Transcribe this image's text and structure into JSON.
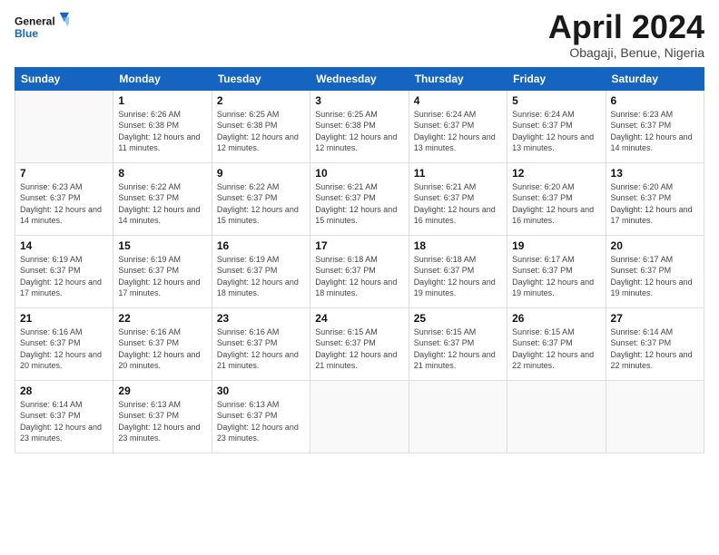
{
  "header": {
    "logo_line1": "General",
    "logo_line2": "Blue",
    "main_title": "April 2024",
    "subtitle": "Obagaji, Benue, Nigeria"
  },
  "calendar": {
    "days_of_week": [
      "Sunday",
      "Monday",
      "Tuesday",
      "Wednesday",
      "Thursday",
      "Friday",
      "Saturday"
    ],
    "weeks": [
      [
        {
          "day": "",
          "info": ""
        },
        {
          "day": "1",
          "info": "Sunrise: 6:26 AM\nSunset: 6:38 PM\nDaylight: 12 hours\nand 11 minutes."
        },
        {
          "day": "2",
          "info": "Sunrise: 6:25 AM\nSunset: 6:38 PM\nDaylight: 12 hours\nand 12 minutes."
        },
        {
          "day": "3",
          "info": "Sunrise: 6:25 AM\nSunset: 6:38 PM\nDaylight: 12 hours\nand 12 minutes."
        },
        {
          "day": "4",
          "info": "Sunrise: 6:24 AM\nSunset: 6:37 PM\nDaylight: 12 hours\nand 13 minutes."
        },
        {
          "day": "5",
          "info": "Sunrise: 6:24 AM\nSunset: 6:37 PM\nDaylight: 12 hours\nand 13 minutes."
        },
        {
          "day": "6",
          "info": "Sunrise: 6:23 AM\nSunset: 6:37 PM\nDaylight: 12 hours\nand 14 minutes."
        }
      ],
      [
        {
          "day": "7",
          "info": "Sunrise: 6:23 AM\nSunset: 6:37 PM\nDaylight: 12 hours\nand 14 minutes."
        },
        {
          "day": "8",
          "info": "Sunrise: 6:22 AM\nSunset: 6:37 PM\nDaylight: 12 hours\nand 14 minutes."
        },
        {
          "day": "9",
          "info": "Sunrise: 6:22 AM\nSunset: 6:37 PM\nDaylight: 12 hours\nand 15 minutes."
        },
        {
          "day": "10",
          "info": "Sunrise: 6:21 AM\nSunset: 6:37 PM\nDaylight: 12 hours\nand 15 minutes."
        },
        {
          "day": "11",
          "info": "Sunrise: 6:21 AM\nSunset: 6:37 PM\nDaylight: 12 hours\nand 16 minutes."
        },
        {
          "day": "12",
          "info": "Sunrise: 6:20 AM\nSunset: 6:37 PM\nDaylight: 12 hours\nand 16 minutes."
        },
        {
          "day": "13",
          "info": "Sunrise: 6:20 AM\nSunset: 6:37 PM\nDaylight: 12 hours\nand 17 minutes."
        }
      ],
      [
        {
          "day": "14",
          "info": "Sunrise: 6:19 AM\nSunset: 6:37 PM\nDaylight: 12 hours\nand 17 minutes."
        },
        {
          "day": "15",
          "info": "Sunrise: 6:19 AM\nSunset: 6:37 PM\nDaylight: 12 hours\nand 17 minutes."
        },
        {
          "day": "16",
          "info": "Sunrise: 6:19 AM\nSunset: 6:37 PM\nDaylight: 12 hours\nand 18 minutes."
        },
        {
          "day": "17",
          "info": "Sunrise: 6:18 AM\nSunset: 6:37 PM\nDaylight: 12 hours\nand 18 minutes."
        },
        {
          "day": "18",
          "info": "Sunrise: 6:18 AM\nSunset: 6:37 PM\nDaylight: 12 hours\nand 19 minutes."
        },
        {
          "day": "19",
          "info": "Sunrise: 6:17 AM\nSunset: 6:37 PM\nDaylight: 12 hours\nand 19 minutes."
        },
        {
          "day": "20",
          "info": "Sunrise: 6:17 AM\nSunset: 6:37 PM\nDaylight: 12 hours\nand 19 minutes."
        }
      ],
      [
        {
          "day": "21",
          "info": "Sunrise: 6:16 AM\nSunset: 6:37 PM\nDaylight: 12 hours\nand 20 minutes."
        },
        {
          "day": "22",
          "info": "Sunrise: 6:16 AM\nSunset: 6:37 PM\nDaylight: 12 hours\nand 20 minutes."
        },
        {
          "day": "23",
          "info": "Sunrise: 6:16 AM\nSunset: 6:37 PM\nDaylight: 12 hours\nand 21 minutes."
        },
        {
          "day": "24",
          "info": "Sunrise: 6:15 AM\nSunset: 6:37 PM\nDaylight: 12 hours\nand 21 minutes."
        },
        {
          "day": "25",
          "info": "Sunrise: 6:15 AM\nSunset: 6:37 PM\nDaylight: 12 hours\nand 21 minutes."
        },
        {
          "day": "26",
          "info": "Sunrise: 6:15 AM\nSunset: 6:37 PM\nDaylight: 12 hours\nand 22 minutes."
        },
        {
          "day": "27",
          "info": "Sunrise: 6:14 AM\nSunset: 6:37 PM\nDaylight: 12 hours\nand 22 minutes."
        }
      ],
      [
        {
          "day": "28",
          "info": "Sunrise: 6:14 AM\nSunset: 6:37 PM\nDaylight: 12 hours\nand 23 minutes."
        },
        {
          "day": "29",
          "info": "Sunrise: 6:13 AM\nSunset: 6:37 PM\nDaylight: 12 hours\nand 23 minutes."
        },
        {
          "day": "30",
          "info": "Sunrise: 6:13 AM\nSunset: 6:37 PM\nDaylight: 12 hours\nand 23 minutes."
        },
        {
          "day": "",
          "info": ""
        },
        {
          "day": "",
          "info": ""
        },
        {
          "day": "",
          "info": ""
        },
        {
          "day": "",
          "info": ""
        }
      ]
    ]
  }
}
